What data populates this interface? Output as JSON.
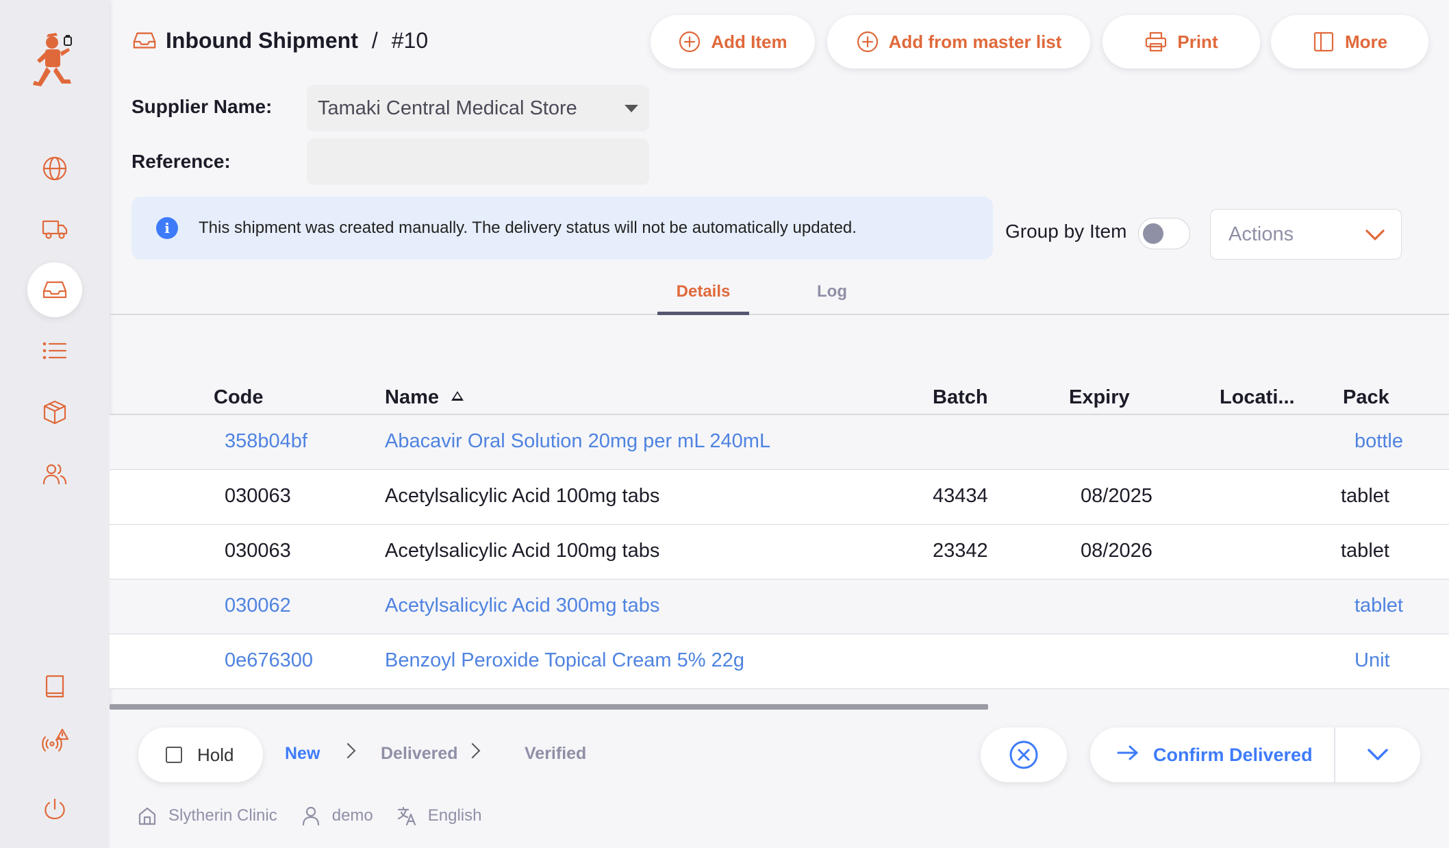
{
  "header": {
    "title": "Inbound Shipment",
    "separator": "/",
    "number": "#10",
    "buttons": {
      "add_item": "Add Item",
      "add_master": "Add from master list",
      "print": "Print",
      "more": "More"
    }
  },
  "form": {
    "supplier_label": "Supplier Name:",
    "supplier_value": "Tamaki Central Medical Store",
    "reference_label": "Reference:",
    "reference_value": ""
  },
  "banner": {
    "text": "This shipment was created manually. The delivery status will not be automatically updated."
  },
  "controls": {
    "group_by_label": "Group by Item",
    "group_by_on": false,
    "actions_placeholder": "Actions"
  },
  "tabs": [
    {
      "label": "Details",
      "active": true
    },
    {
      "label": "Log",
      "active": false
    }
  ],
  "table": {
    "columns": [
      "Code",
      "Name",
      "Batch",
      "Expiry",
      "Locati...",
      "Pack"
    ],
    "sort": {
      "column": "Name",
      "direction": "ascending"
    },
    "rows": [
      {
        "code": "358b04bf",
        "name": "Abacavir Oral Solution 20mg per mL 240mL",
        "batch": "",
        "expiry": "",
        "location": "",
        "pack": "bottle",
        "placeholder": true
      },
      {
        "code": "030063",
        "name": "Acetylsalicylic Acid 100mg tabs",
        "batch": "43434",
        "expiry": "08/2025",
        "location": "",
        "pack": "tablet",
        "placeholder": false
      },
      {
        "code": "030063",
        "name": "Acetylsalicylic Acid 100mg tabs",
        "batch": "23342",
        "expiry": "08/2026",
        "location": "",
        "pack": "tablet",
        "placeholder": false
      },
      {
        "code": "030062",
        "name": "Acetylsalicylic Acid 300mg tabs",
        "batch": "",
        "expiry": "",
        "location": "",
        "pack": "tablet",
        "placeholder": true
      },
      {
        "code": "0e676300",
        "name": "Benzoyl Peroxide Topical Cream 5% 22g",
        "batch": "",
        "expiry": "",
        "location": "",
        "pack": "Unit",
        "placeholder": true
      }
    ]
  },
  "footer": {
    "hold_label": "Hold",
    "statuses": [
      "New",
      "Delivered",
      "Verified"
    ],
    "current_status": "New",
    "confirm_label": "Confirm Delivered"
  },
  "statusbar": {
    "store": "Slytherin Clinic",
    "user": "demo",
    "language": "English"
  },
  "colors": {
    "accent": "#e0693b",
    "primary": "#3e7bfa",
    "placeholder_row_text": "#4f83e0",
    "banner_bg": "#e6eefb"
  }
}
